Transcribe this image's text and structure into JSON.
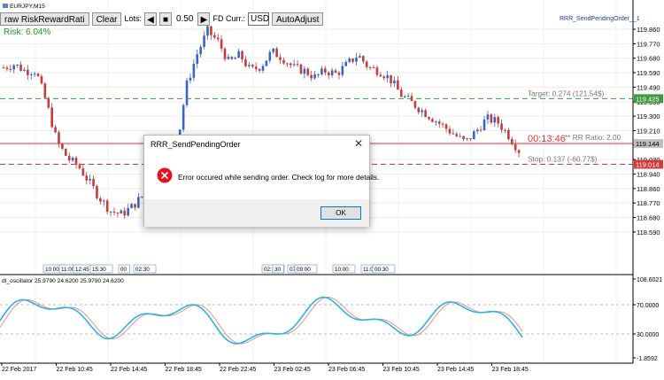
{
  "chart": {
    "symbol_label": "EURJPY,M15",
    "risk_label": "Risk: 6.04%",
    "indicator_label": "RRR_SendPendingOrder__1",
    "osc_label": "dt_oscillator 25.9790 24.6200 25.9790 24.6200",
    "colors": {
      "up": "#3a64c4",
      "down": "#c43c3c",
      "target_line": "#3f9a3f",
      "stop_line": "#d63a3a",
      "risk_text": "#1fa11f"
    }
  },
  "toolbar": {
    "draw_label": "raw RiskRewardRati",
    "clear_label": "Clear",
    "lots_label": "Lots:",
    "lots_value": "0.50",
    "fd_label": "FD Curr.:",
    "currency_value": "USD",
    "autoadjust_label": "AutoAdjust"
  },
  "levels": {
    "target_text": "Target: 0.274 (121.54$)",
    "stop_text": "Stop: 0.137 (-60.77$)",
    "rr_text": "** RR Ratio: 2.00",
    "timer": "00:13:46",
    "target_price": "119.425",
    "current_price": "119.144",
    "stop_price": "119.014"
  },
  "price_axis": [
    "119.860",
    "119.770",
    "119.680",
    "119.590",
    "119.490",
    "119.390",
    "119.300",
    "119.210",
    "119.120",
    "119.030",
    "118.940",
    "118.860",
    "118.770",
    "118.680",
    "118.590"
  ],
  "osc_axis": [
    "108.6021",
    "70.0000",
    "30.0000",
    "-1.8592"
  ],
  "time_axis": [
    "22 Feb 2017",
    "22 Feb 10:45",
    "22 Feb 14:45",
    "22 Feb 18:45",
    "22 Feb 22:45",
    "23 Feb 02:45",
    "23 Feb 06:45",
    "23 Feb 10:45",
    "23 Feb 14:45",
    "23 Feb 18:45"
  ],
  "session_tags": [
    "10:00",
    "11:00",
    "12:45",
    "15:30",
    "00",
    "02:30",
    "02:30",
    "30",
    "07:00",
    "09:00",
    "10:00",
    "11:00",
    "00:30"
  ],
  "dialog": {
    "title": "RRR_SendPendingOrder",
    "message": "Error occured while sending order. Check log for more details.",
    "ok_label": "OK",
    "close_glyph": "✕"
  }
}
